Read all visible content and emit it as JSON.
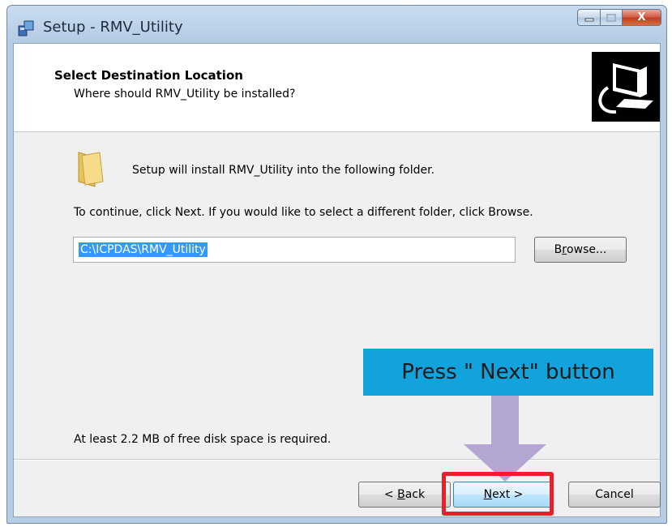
{
  "window": {
    "title": "Setup - RMV_Utility",
    "minimize_label": "",
    "maximize_label": "",
    "close_label": "X"
  },
  "header": {
    "title": "Select Destination Location",
    "subtitle": "Where should RMV_Utility be installed?",
    "logo_icon": "computer-install-icon"
  },
  "body": {
    "folder_icon": "folder-icon",
    "intro": "Setup will install RMV_Utility into the following folder.",
    "continue_text": "To continue, click Next. If you would like to select a different folder, click Browse.",
    "path_value": "C:\\ICPDAS\\RMV_Utility",
    "browse_pre": "B",
    "browse_mnemonic": "r",
    "browse_post": "owse...",
    "space_required": "At least 2.2 MB of free disk space is required."
  },
  "footer": {
    "back_pre": "< ",
    "back_mnemonic": "B",
    "back_post": "ack",
    "next_mnemonic": "N",
    "next_post": "ext >",
    "cancel_label": "Cancel"
  },
  "annotation": {
    "callout_text": "Press \" Next\" button",
    "callout_color": "#12a3dc",
    "arrow_color": "#b3a6d3",
    "highlight_color": "#e8202a"
  }
}
